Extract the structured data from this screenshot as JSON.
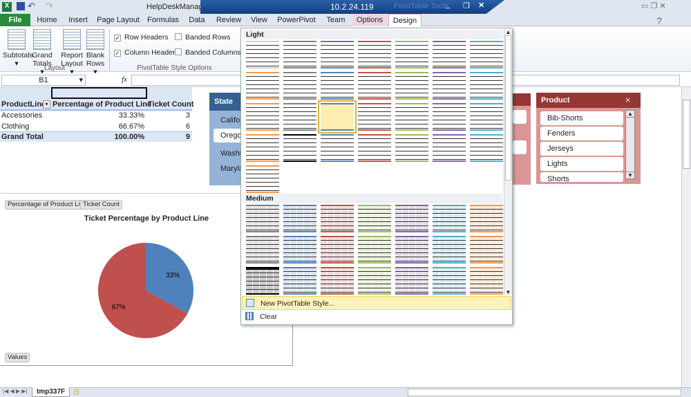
{
  "titlebar": {
    "title": "HelpDeskManager - Microsoft Excel",
    "remote_host": "10.2.24.119",
    "context_title": "PivotTable Tools"
  },
  "tabs": [
    "File",
    "Home",
    "Insert",
    "Page Layout",
    "Formulas",
    "Data",
    "Review",
    "View",
    "PowerPivot",
    "Team",
    "Options",
    "Design"
  ],
  "active_tab": "Design",
  "ribbon": {
    "layout": {
      "label": "Layout",
      "buttons": [
        "Subtotals",
        "Grand Totals",
        "Report Layout",
        "Blank Rows"
      ]
    },
    "style_options": {
      "label": "PivotTable Style Options",
      "row_headers": {
        "label": "Row Headers",
        "checked": true
      },
      "column_headers": {
        "label": "Column Headers",
        "checked": true
      },
      "banded_rows": {
        "label": "Banded Rows",
        "checked": false
      },
      "banded_columns": {
        "label": "Banded Columns",
        "checked": false
      }
    }
  },
  "formula_bar": {
    "name_box": "B1",
    "fx": "fx",
    "formula": ""
  },
  "pivot": {
    "headers": [
      "ProductLine",
      "Percentage of Product Line",
      "Ticket Count"
    ],
    "rows": [
      [
        "Accessories",
        "33.33%",
        "3"
      ],
      [
        "Clothing",
        "66.67%",
        "6"
      ]
    ],
    "total": [
      "Grand Total",
      "100.00%",
      "9"
    ]
  },
  "state_slicer": {
    "title": "State",
    "items": [
      "Califor",
      "Oregon",
      "Washin",
      "Maryla"
    ],
    "selected": "Oregon",
    "color": "#95b3d7"
  },
  "product_slicer": {
    "title": "Product",
    "items": [
      "Bib-Shorts",
      "Fenders",
      "Jerseys",
      "Lights",
      "Shorts"
    ],
    "color": "#953735"
  },
  "chart": {
    "field_buttons": [
      "Percentage of Product Line",
      "Ticket Count"
    ],
    "axis_button": "Values",
    "chart_data": {
      "type": "pie",
      "title": "Ticket Percentage by Product Line",
      "categories": [
        "Accessories",
        "Clothing"
      ],
      "values": [
        33,
        67
      ],
      "labels": [
        "33%",
        "67%"
      ],
      "colors": [
        "#4f81bd",
        "#c0504d"
      ]
    }
  },
  "gallery": {
    "light_label": "Light",
    "medium_label": "Medium",
    "selected": "Light row 3 column 3",
    "light_rows": [
      [
        "#ffffff",
        "#7f7f7f",
        "#4f81bd",
        "#c0504d",
        "#9bbb59",
        "#8064a2",
        "#4bacc6"
      ],
      [
        "#f79646",
        "#7f7f7f",
        "#4f81bd",
        "#c0504d",
        "#9bbb59",
        "#8064a2",
        "#4bacc6"
      ],
      [
        "#f79646",
        "#7f7f7f",
        "#4f81bd",
        "#c0504d",
        "#9bbb59",
        "#8064a2",
        "#4bacc6"
      ],
      [
        "#f79646",
        "#000000",
        "#4f81bd",
        "#c0504d",
        "#9bbb59",
        "#8064a2",
        "#4bacc6"
      ],
      [
        "#f79646"
      ]
    ],
    "medium_rows": [
      [
        "#7f7f7f",
        "#4f81bd",
        "#c0504d",
        "#9bbb59",
        "#8064a2",
        "#4bacc6",
        "#f79646"
      ],
      [
        "#7f7f7f",
        "#4f81bd",
        "#c0504d",
        "#9bbb59",
        "#8064a2",
        "#4bacc6",
        "#f79646"
      ],
      [
        "#000000",
        "#4f81bd",
        "#c0504d",
        "#9bbb59",
        "#8064a2",
        "#4bacc6",
        "#f79646"
      ]
    ],
    "new_style": "New PivotTable Style...",
    "clear": "Clear"
  },
  "sheet_tab": "tmp337F"
}
